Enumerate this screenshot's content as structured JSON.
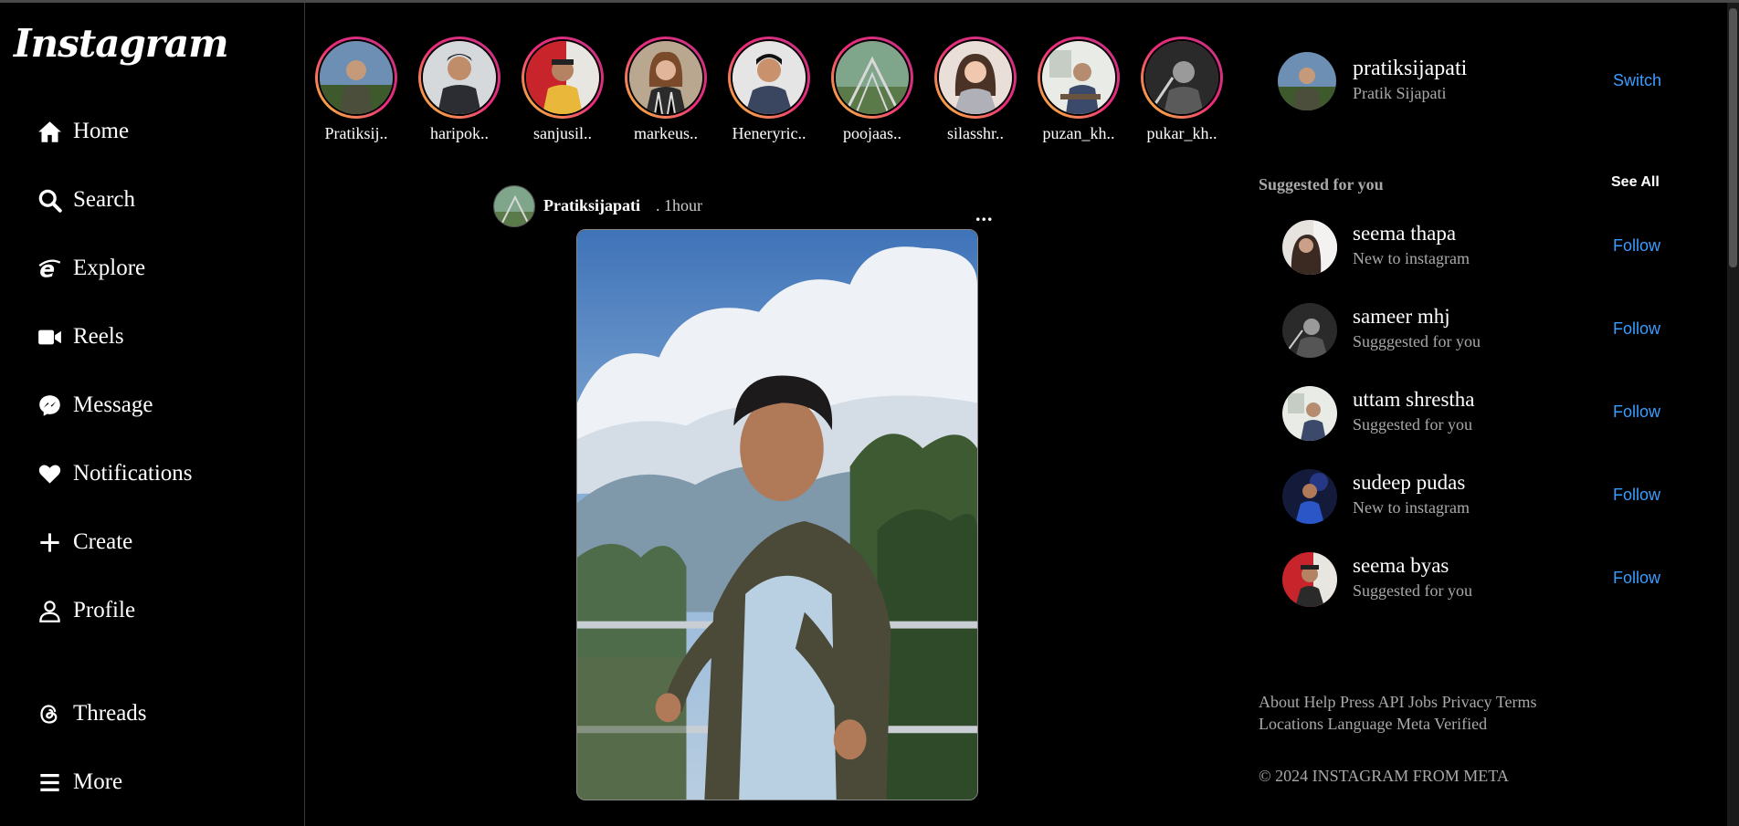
{
  "brand": {
    "logo_text": "Instagram"
  },
  "nav": {
    "items": [
      {
        "label": "Home",
        "icon": "home-icon"
      },
      {
        "label": "Search",
        "icon": "search-icon"
      },
      {
        "label": "Explore",
        "icon": "explore-icon"
      },
      {
        "label": "Reels",
        "icon": "reels-icon"
      },
      {
        "label": "Message",
        "icon": "messenger-icon"
      },
      {
        "label": "Notifications",
        "icon": "heart-icon"
      },
      {
        "label": "Create",
        "icon": "plus-icon"
      },
      {
        "label": "Profile",
        "icon": "user-icon"
      },
      {
        "label": "Threads",
        "icon": "threads-icon"
      },
      {
        "label": "More",
        "icon": "menu-icon"
      }
    ]
  },
  "stories": [
    {
      "name": "Pratiksij.."
    },
    {
      "name": "haripok.."
    },
    {
      "name": "sanjusil.."
    },
    {
      "name": "markeus.."
    },
    {
      "name": "Heneryric.."
    },
    {
      "name": "poojaas.."
    },
    {
      "name": "silasshr.."
    },
    {
      "name": "puzan_kh.."
    },
    {
      "name": "pukar_kh.."
    }
  ],
  "post": {
    "username": "Pratiksijapati",
    "time": ". 1hour",
    "more": "..."
  },
  "current_user": {
    "username": "pratiksijapati",
    "full_name": "Pratik Sijapati",
    "switch_label": "Switch"
  },
  "suggestions": {
    "title": "Suggested for you",
    "see_all": "See All",
    "follow_label": "Follow",
    "items": [
      {
        "name": "seema thapa",
        "subtitle": "New to instagram"
      },
      {
        "name": "sameer mhj",
        "subtitle": "Sugggested for you"
      },
      {
        "name": "uttam shrestha",
        "subtitle": "Suggested for you"
      },
      {
        "name": "sudeep pudas",
        "subtitle": "New to instagram"
      },
      {
        "name": "seema byas",
        "subtitle": "Suggested for you"
      }
    ]
  },
  "footer": {
    "links": [
      "About",
      "Help",
      "Press",
      "API",
      "Jobs",
      "Privacy",
      "Terms",
      "Locations",
      "Language",
      "Meta Verified"
    ],
    "copyright": "© 2024 INSTAGRAM FROM META"
  },
  "colors": {
    "background": "#000000",
    "link_blue": "#3a9cff",
    "muted_text": "#a8a8a8",
    "story_ring_start": "#f9ce34",
    "story_ring_mid": "#ee2a7b",
    "story_ring_end": "#c13584"
  }
}
